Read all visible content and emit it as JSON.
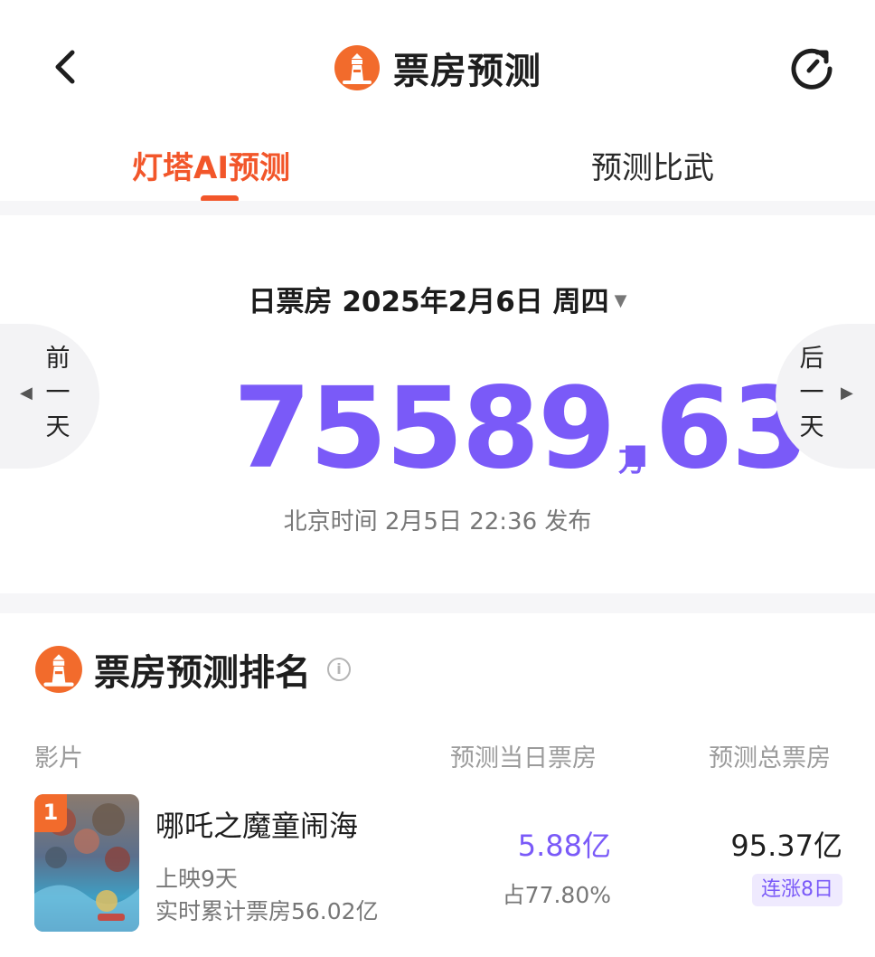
{
  "header": {
    "title": "票房预测",
    "icons": {
      "back": "chevron-left-icon",
      "logo": "lighthouse-logo-icon",
      "refresh": "refresh-icon"
    }
  },
  "tabs": [
    {
      "label": "灯塔AI预测",
      "active": true
    },
    {
      "label": "预测比武",
      "active": false
    }
  ],
  "summary": {
    "date_label": "日票房 2025年2月6日 周四",
    "prev_label": [
      "前",
      "一",
      "天"
    ],
    "next_label": [
      "后",
      "一",
      "天"
    ],
    "amount": "75589.63",
    "unit": "万",
    "published": "北京时间 2月5日 22:36 发布"
  },
  "ranking": {
    "title": "票房预测排名",
    "columns": {
      "film": "影片",
      "day": "预测当日票房",
      "total": "预测总票房"
    },
    "movies": [
      {
        "rank": "1",
        "name": "哪吒之魔童闹海",
        "days": "上映9天",
        "cumulative": "实时累计票房56.02亿",
        "pred_day": "5.88亿",
        "share": "占77.80%",
        "pred_total": "95.37亿",
        "streak": "连涨8日"
      }
    ]
  },
  "colors": {
    "accent_orange": "#f2562a",
    "accent_purple": "#7a5af8",
    "streak_bg": "#efeafe"
  }
}
